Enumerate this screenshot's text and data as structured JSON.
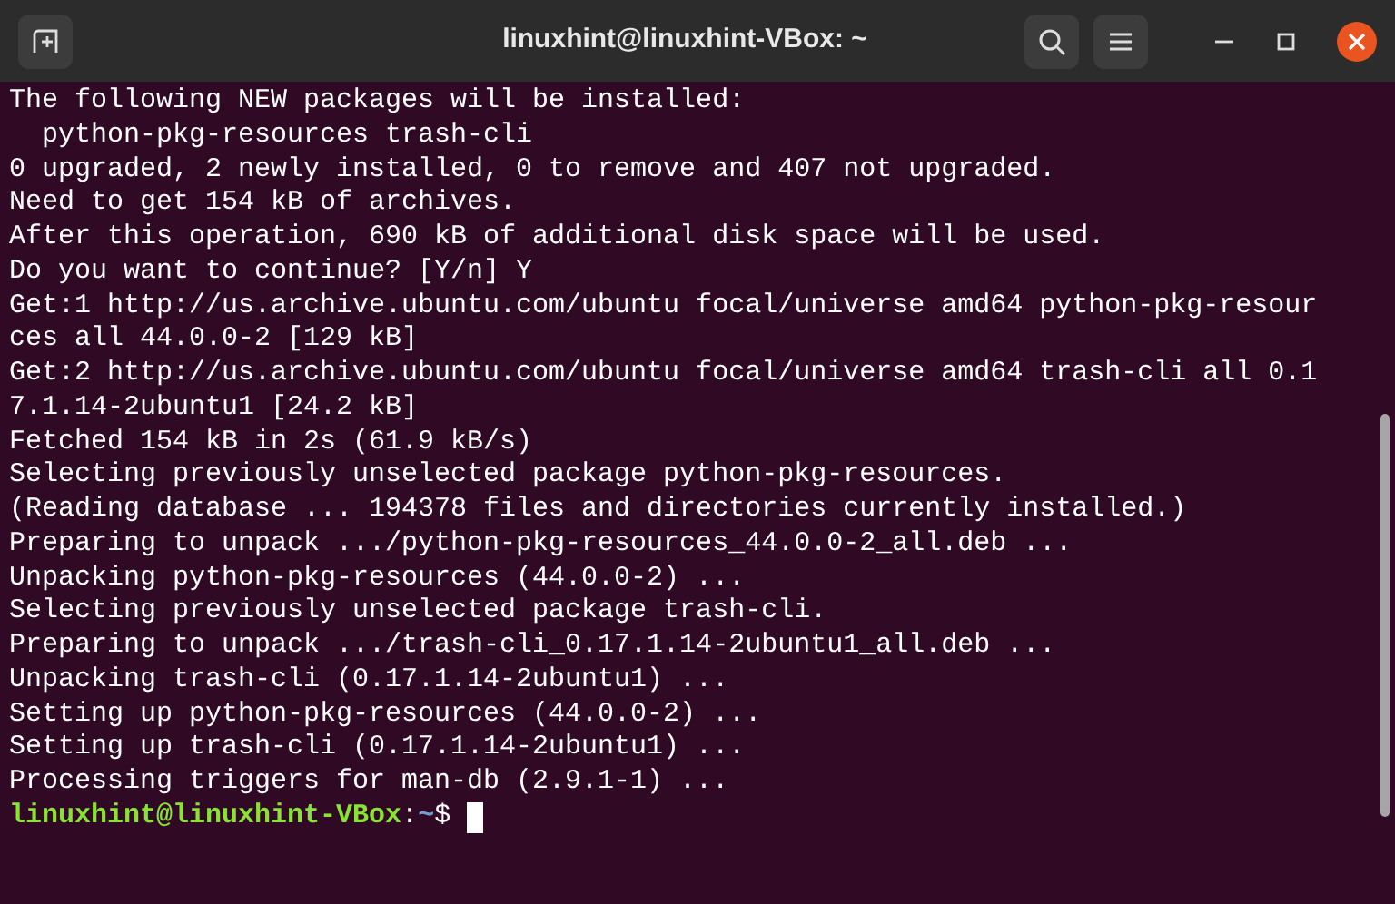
{
  "window": {
    "title": "linuxhint@linuxhint-VBox: ~"
  },
  "lines": [
    "The following NEW packages will be installed:",
    "  python-pkg-resources trash-cli",
    "0 upgraded, 2 newly installed, 0 to remove and 407 not upgraded.",
    "Need to get 154 kB of archives.",
    "After this operation, 690 kB of additional disk space will be used.",
    "Do you want to continue? [Y/n] Y",
    "Get:1 http://us.archive.ubuntu.com/ubuntu focal/universe amd64 python-pkg-resour",
    "ces all 44.0.0-2 [129 kB]",
    "Get:2 http://us.archive.ubuntu.com/ubuntu focal/universe amd64 trash-cli all 0.1",
    "7.1.14-2ubuntu1 [24.2 kB]",
    "Fetched 154 kB in 2s (61.9 kB/s)",
    "Selecting previously unselected package python-pkg-resources.",
    "(Reading database ... 194378 files and directories currently installed.)",
    "Preparing to unpack .../python-pkg-resources_44.0.0-2_all.deb ...",
    "Unpacking python-pkg-resources (44.0.0-2) ...",
    "Selecting previously unselected package trash-cli.",
    "Preparing to unpack .../trash-cli_0.17.1.14-2ubuntu1_all.deb ...",
    "Unpacking trash-cli (0.17.1.14-2ubuntu1) ...",
    "Setting up python-pkg-resources (44.0.0-2) ...",
    "Setting up trash-cli (0.17.1.14-2ubuntu1) ...",
    "Processing triggers for man-db (2.9.1-1) ..."
  ],
  "prompt": {
    "user_host": "linuxhint@linuxhint-VBox",
    "separator": ":",
    "path": "~",
    "symbol": "$"
  }
}
